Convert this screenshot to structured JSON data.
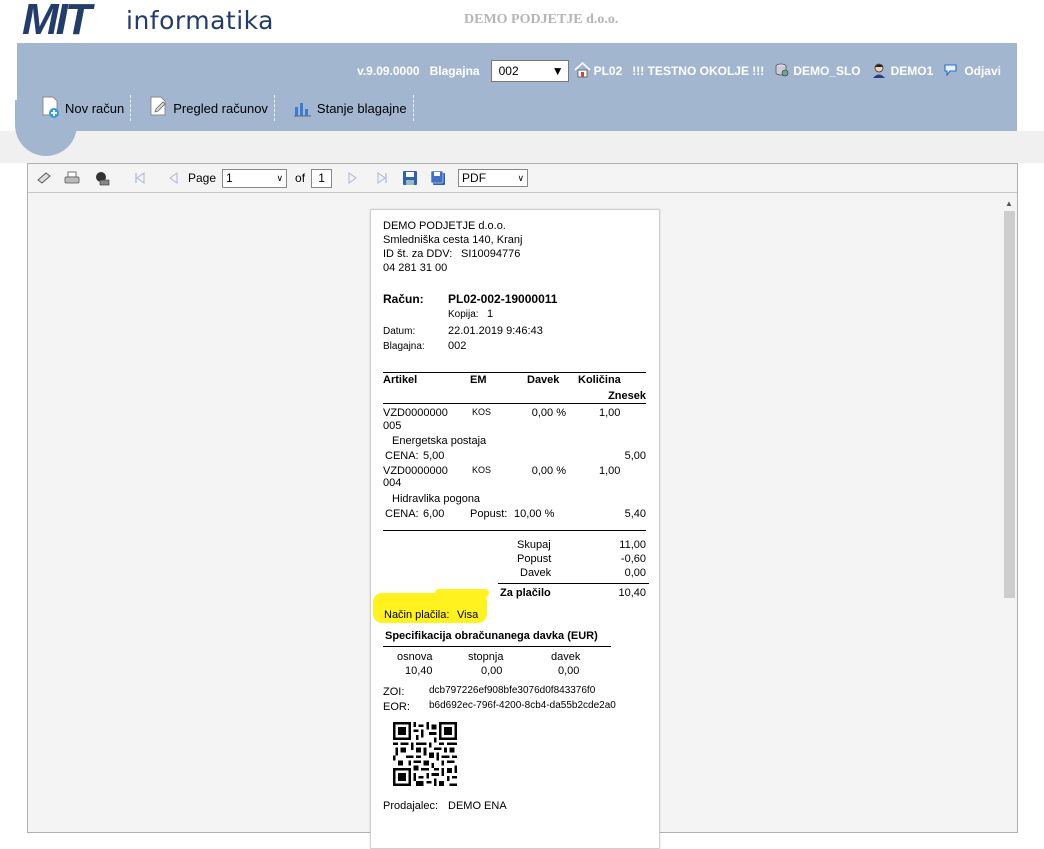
{
  "header": {
    "logo_main": "MIT",
    "logo_tail": "informatika",
    "company": "DEMO PODJETJE d.o.o."
  },
  "statusbar": {
    "version": "v.9.09.0000",
    "kasa_label": "Blagajna",
    "kasa_value": "002",
    "location": "PL02",
    "test_env": "!!! TESTNO OKOLJE !!!",
    "database": "DEMO_SLO",
    "user": "DEMO1",
    "logout": "Odjavi"
  },
  "menu": {
    "new_invoice": "Nov račun",
    "review_invoices": "Pregled računov",
    "cash_state": "Stanje blagajne"
  },
  "report_toolbar": {
    "page_label": "Page",
    "page_value": "1",
    "of_label": "of",
    "total_pages": "1",
    "format": "PDF"
  },
  "receipt": {
    "company": "DEMO PODJETJE d.o.o.",
    "address": "Smledniška cesta 140, Kranj",
    "vat_label": "ID št. za DDV:",
    "vat_value": "SI10094776",
    "phone": "04 281 31 00",
    "invoice_label": "Račun:",
    "invoice_no": "PL02-002-19000011",
    "copy_label": "Kopija:",
    "copy_value": "1",
    "date_label": "Datum:",
    "date_value": "22.01.2019 9:46:43",
    "register_label": "Blagajna:",
    "register_value": "002",
    "col_article": "Artikel",
    "col_em": "EM",
    "col_tax": "Davek",
    "col_qty": "Količina",
    "col_amount": "Znesek",
    "items": [
      {
        "code1": "VZD0000000",
        "code2": "005",
        "em": "KOS",
        "tax": "0,00  %",
        "qty": "1,00",
        "name": "Energetska postaja",
        "price_label": "CENA:",
        "price": "5,00",
        "discount_label": "",
        "discount": "",
        "amount": "5,00"
      },
      {
        "code1": "VZD0000000",
        "code2": "004",
        "em": "KOS",
        "tax": "0,00  %",
        "qty": "1,00",
        "name": "Hidravlika pogona",
        "price_label": "CENA:",
        "price": "6,00",
        "discount_label": "Popust:",
        "discount": "10,00  %",
        "amount": "5,40"
      }
    ],
    "sum_label": "Skupaj",
    "sum_value": "11,00",
    "discount_label": "Popust",
    "discount_value": "-0,60",
    "tax_label": "Davek",
    "tax_value": "0,00",
    "pay_label": "Za plačilo",
    "pay_value": "10,40",
    "method_label": "Način plačila:",
    "method_value": "Visa",
    "spec_title": "Specifikacija obračunanega davka (EUR)",
    "spec_cols": [
      "osnova",
      "stopnja",
      "davek"
    ],
    "spec_vals": [
      "10,40",
      "0,00",
      "0,00"
    ],
    "zoi_label": "ZOI:",
    "zoi_value": "dcb797226ef908bfe3076d0f843376f0",
    "eor_label": "EOR:",
    "eor_value": "b6d692ec-796f-4200-8cb4-da55b2cde2a0",
    "seller_label": "Prodajalec:",
    "seller_value": "DEMO ENA"
  },
  "colors": {
    "brand": "#233d6b",
    "bar": "#a3b6d0",
    "highlight": "#fff21e"
  },
  "icons": [
    "home-icon",
    "database-icon",
    "user-icon",
    "logout-icon",
    "new-invoice-icon",
    "review-icon",
    "chart-icon",
    "print-icon",
    "export-icon",
    "save-icon"
  ]
}
